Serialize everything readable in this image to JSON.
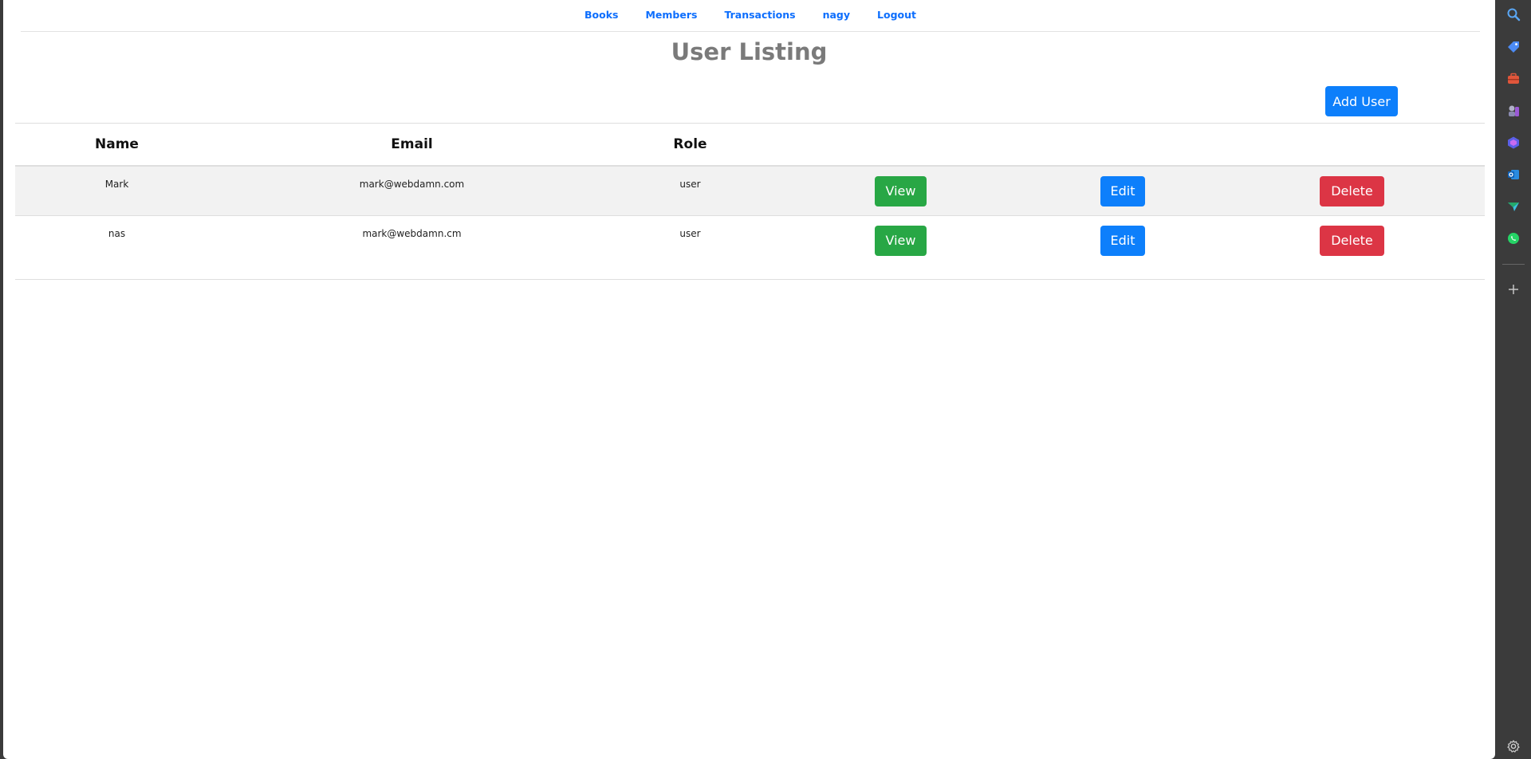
{
  "nav": {
    "items": [
      "Books",
      "Members",
      "Transactions",
      "nagy",
      "Logout"
    ]
  },
  "page": {
    "title": "User Listing",
    "add_user_label": "Add User"
  },
  "table": {
    "headers": {
      "name": "Name",
      "email": "Email",
      "role": "Role"
    },
    "rows": [
      {
        "name": "Mark",
        "email": "mark@webdamn.com",
        "role": "user",
        "view": "View",
        "edit": "Edit",
        "delete": "Delete"
      },
      {
        "name": "nas",
        "email": "mark@webdamn.cm",
        "role": "user",
        "view": "View",
        "edit": "Edit",
        "delete": "Delete"
      }
    ]
  },
  "sidebar": {
    "icons": [
      "search-icon",
      "tag-icon",
      "briefcase-icon",
      "chess-icon",
      "copilot-icon",
      "outlook-icon",
      "send-icon",
      "whatsapp-icon",
      "add-icon",
      "settings-icon"
    ]
  },
  "colors": {
    "link": "#0d6efd",
    "primary": "#0d7ffb",
    "success": "#28a745",
    "danger": "#dc3545",
    "title": "#7a7a7a",
    "sidebar_bg": "#3b3b3b"
  }
}
